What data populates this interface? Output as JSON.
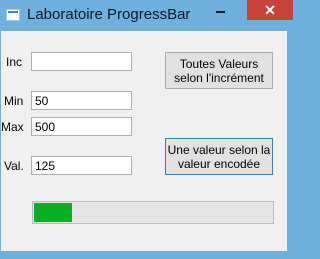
{
  "window": {
    "title": "Laboratoire ProgressBar",
    "icon": "form-icon",
    "controls": {
      "minimize": "minimize-icon",
      "maximize": "maximize-icon",
      "close": "✕"
    },
    "close_color": "#c7443a",
    "frame_color": "#6fb0dd"
  },
  "form": {
    "inc": {
      "label": "Inc",
      "value": ""
    },
    "min": {
      "label": "Min",
      "value": "50"
    },
    "max": {
      "label": "Max",
      "value": "500"
    },
    "val": {
      "label": "Val.",
      "value": "125"
    }
  },
  "buttons": {
    "all_values": "Toutes Valeurs\nselon l'incrément",
    "one_value": "Une valeur selon la\nvaleur encodée"
  },
  "progress": {
    "min": 50,
    "max": 500,
    "value": 125,
    "fill_fraction": 0.16,
    "color": "#06b025"
  }
}
